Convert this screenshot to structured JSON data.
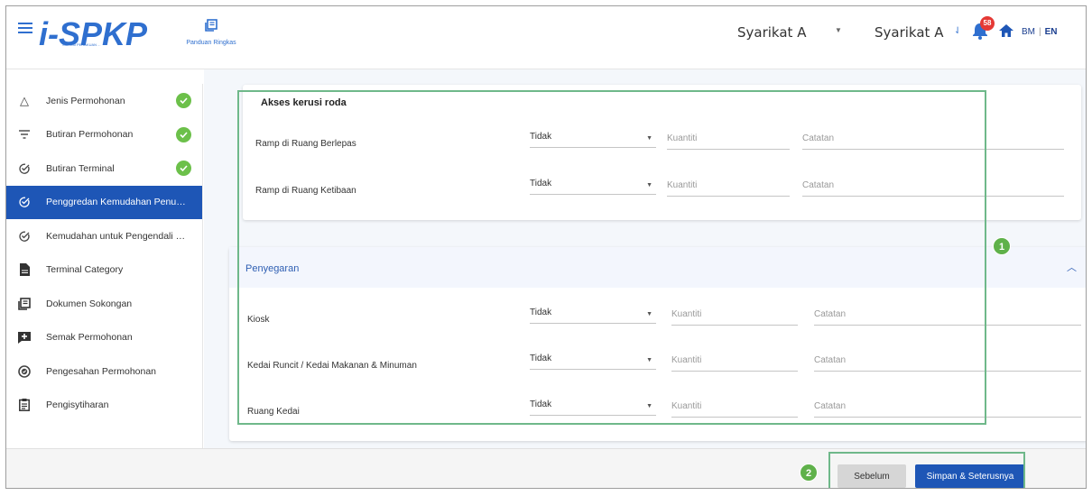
{
  "header": {
    "logo_text": "i-SPKP",
    "logo_tagline": "SISTEM PERAKUAN ...",
    "guide_label": "Panduan Ringkas",
    "user_name": "Syarikat A",
    "company_name": "Syarikat A",
    "notification_count": "58",
    "lang_bm": "BM",
    "lang_sep": "|",
    "lang_en": "EN"
  },
  "sidebar": {
    "items": [
      {
        "label": "Jenis Permohonan",
        "icon": "triangle-icon",
        "done": true
      },
      {
        "label": "Butiran Permohonan",
        "icon": "filter-icon",
        "done": true
      },
      {
        "label": "Butiran Terminal",
        "icon": "check-circle-icon",
        "done": true
      },
      {
        "label": "Penggredan Kemudahan Penump...",
        "icon": "check-circle-icon",
        "active": true
      },
      {
        "label": "Kemudahan untuk Pengendali Ba...",
        "icon": "check-circle-icon"
      },
      {
        "label": "Terminal Category",
        "icon": "document-icon"
      },
      {
        "label": "Dokumen Sokongan",
        "icon": "library-icon"
      },
      {
        "label": "Semak Permohonan",
        "icon": "add-box-icon"
      },
      {
        "label": "Pengesahan Permohonan",
        "icon": "verified-icon"
      },
      {
        "label": "Pengisytiharan",
        "icon": "clipboard-icon"
      }
    ]
  },
  "section_wheelchair": {
    "title": "Akses kerusi roda",
    "rows": [
      {
        "label": "Ramp di Ruang Berlepas",
        "select": "Tidak",
        "qty_placeholder": "Kuantiti",
        "note_placeholder": "Catatan"
      },
      {
        "label": "Ramp di Ruang Ketibaan",
        "select": "Tidak",
        "qty_placeholder": "Kuantiti",
        "note_placeholder": "Catatan"
      }
    ]
  },
  "section_refresh": {
    "title": "Penyegaran",
    "rows": [
      {
        "label": "Kiosk",
        "select": "Tidak",
        "qty_placeholder": "Kuantiti",
        "note_placeholder": "Catatan"
      },
      {
        "label": "Kedai Runcit / Kedai Makanan & Minuman",
        "select": "Tidak",
        "qty_placeholder": "Kuantiti",
        "note_placeholder": "Catatan"
      },
      {
        "label": "Ruang Kedai",
        "select": "Tidak",
        "qty_placeholder": "Kuantiti",
        "note_placeholder": "Catatan"
      }
    ]
  },
  "footer": {
    "prev_label": "Sebelum",
    "next_label": "Simpan & Seterusnya"
  },
  "annotations": {
    "one": "1",
    "two": "2"
  },
  "colors": {
    "primary": "#1e56b6",
    "success": "#6cc04a",
    "annotation": "#6fb88a",
    "badge": "#e53935"
  }
}
